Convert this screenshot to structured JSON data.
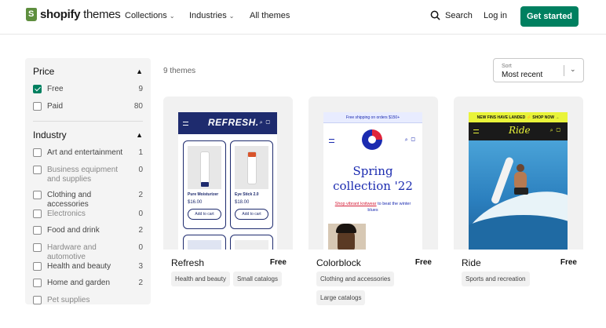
{
  "header": {
    "logo_brand": "shopify",
    "logo_suffix": " themes",
    "nav": [
      {
        "label": "Collections"
      },
      {
        "label": "Industries"
      },
      {
        "label": "All themes"
      }
    ],
    "search_label": "Search",
    "login_label": "Log in",
    "cta_label": "Get started"
  },
  "sidebar": {
    "price": {
      "title": "Price",
      "options": [
        {
          "label": "Free",
          "count": "9",
          "checked": true
        },
        {
          "label": "Paid",
          "count": "80",
          "checked": false
        }
      ]
    },
    "industry": {
      "title": "Industry",
      "options": [
        {
          "label": "Art and entertainment",
          "count": "1"
        },
        {
          "label": "Business equipment and supplies",
          "count": "0"
        },
        {
          "label": "Clothing and accessories",
          "count": "2"
        },
        {
          "label": "Electronics",
          "count": "0"
        },
        {
          "label": "Food and drink",
          "count": "2"
        },
        {
          "label": "Hardware and automotive",
          "count": "0"
        },
        {
          "label": "Health and beauty",
          "count": "3"
        },
        {
          "label": "Home and garden",
          "count": "2"
        },
        {
          "label": "Pet supplies",
          "count": ""
        }
      ]
    }
  },
  "results": {
    "count_label": "9 themes",
    "sort": {
      "label": "Sort",
      "value": "Most recent"
    }
  },
  "colors": {
    "brand_green": "#008060",
    "refresh_navy": "#1e2b6e",
    "colorblock_blue": "#1b2bb0",
    "ride_yellow": "#e9f43a"
  },
  "themes": [
    {
      "name": "Refresh",
      "price": "Free",
      "tags": [
        "Health and beauty",
        "Small catalogs"
      ],
      "preview": {
        "title": "REFRESH.",
        "products": [
          {
            "name": "Pure Moisturizer",
            "price": "$16.00",
            "button": "Add to cart"
          },
          {
            "name": "Eye Stick 2.0",
            "price": "$18.00",
            "button": "Add to cart"
          }
        ]
      }
    },
    {
      "name": "Colorblock",
      "price": "Free",
      "tags": [
        "Clothing and accessories",
        "Large catalogs"
      ],
      "preview": {
        "shipping": "Free shipping on orders $150+",
        "headline_1": "Spring",
        "headline_2": "collection '22",
        "link": "Shop vibrant knitwear",
        "sub": " to beat the winter blues"
      }
    },
    {
      "name": "Ride",
      "price": "Free",
      "tags": [
        "Sports and recreation"
      ],
      "preview": {
        "promo": "NEW FINS HAVE LANDED ⚡ SHOP NOW →",
        "logo": "Ride"
      }
    }
  ]
}
